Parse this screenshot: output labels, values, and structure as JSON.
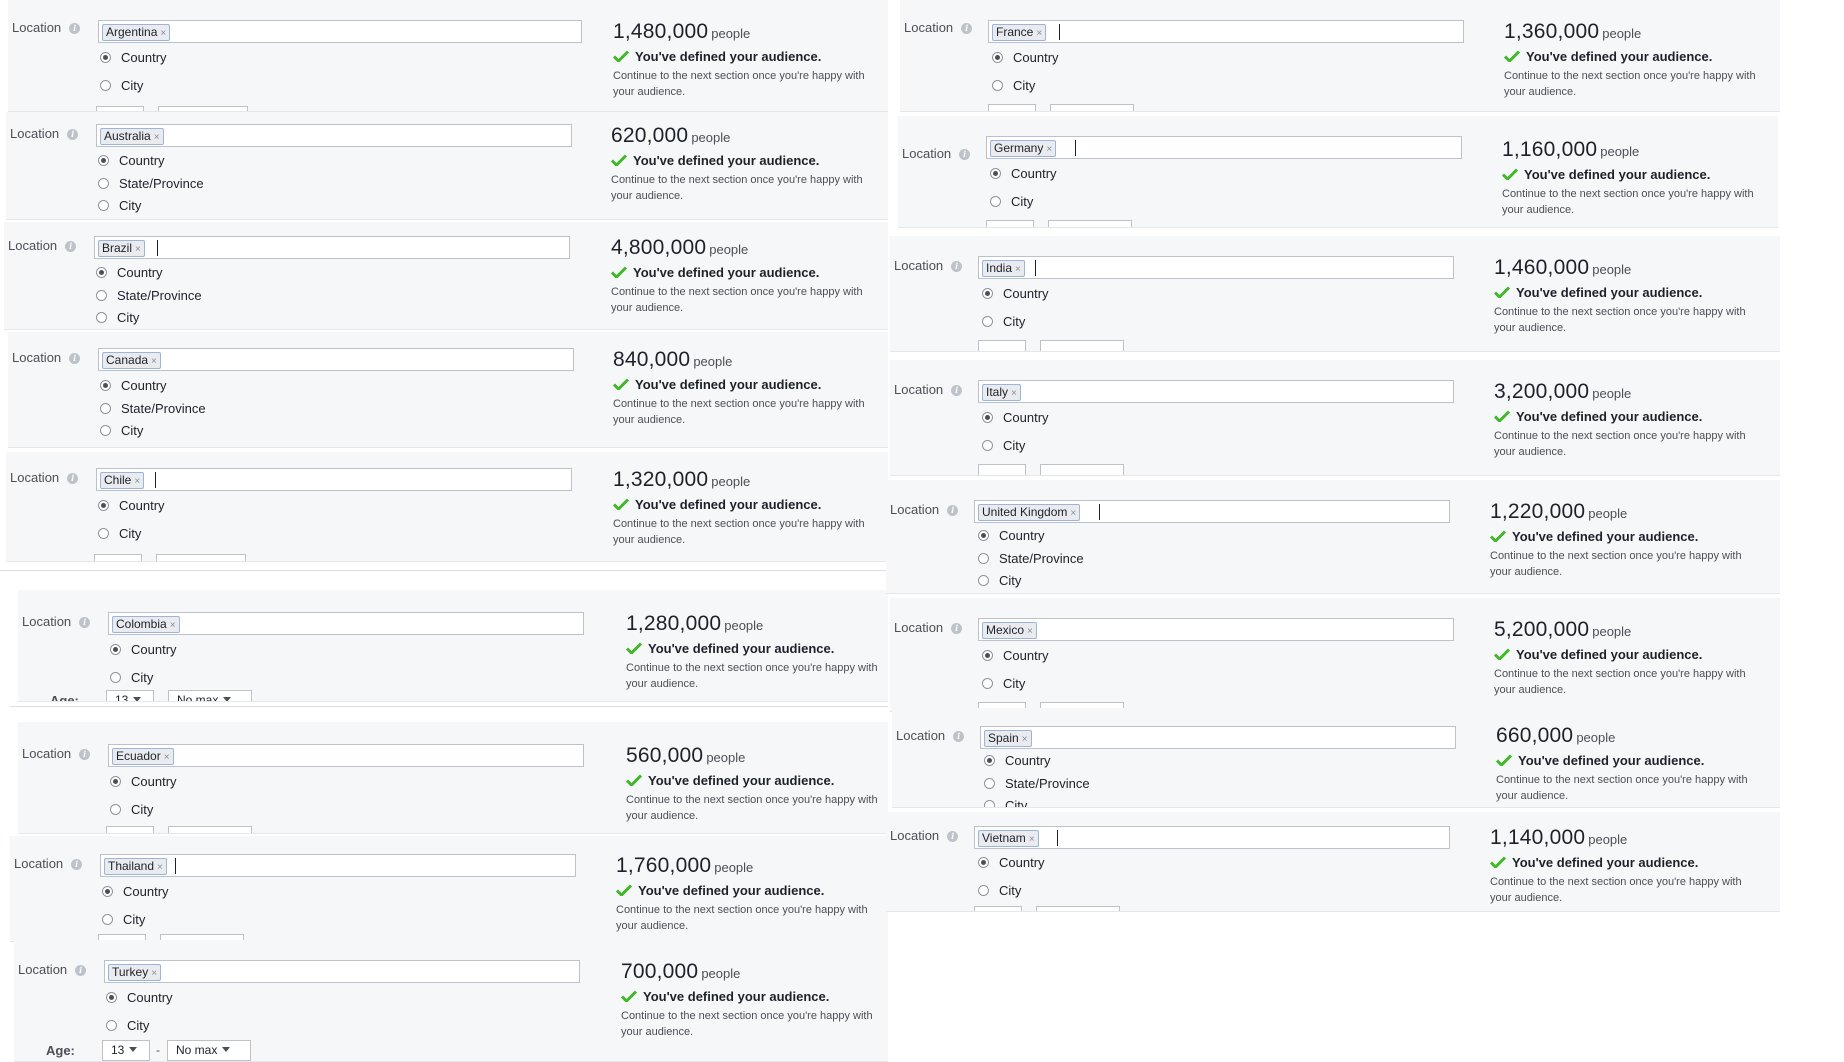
{
  "common": {
    "location_label": "Location",
    "info_icon": "i",
    "remove_icon": "×",
    "people_label": "people",
    "defined_text": "You've defined your audience.",
    "help_text": "Continue to the next section once you're happy with your audience.",
    "age_label": "Age:",
    "age_min": "13",
    "age_max": "No max",
    "age_separator": "-",
    "accent_green": "#42b72a"
  },
  "panels": [
    {
      "country": "Argentina",
      "count": "1,480,000",
      "options": [
        {
          "label": "Country",
          "selected": true
        },
        {
          "label": "City",
          "selected": false
        }
      ],
      "caret": false
    },
    {
      "country": "Australia",
      "count": "620,000",
      "options": [
        {
          "label": "Country",
          "selected": true
        },
        {
          "label": "State/Province",
          "selected": false
        },
        {
          "label": "City",
          "selected": false
        }
      ],
      "caret": false
    },
    {
      "country": "Brazil",
      "count": "4,800,000",
      "options": [
        {
          "label": "Country",
          "selected": true
        },
        {
          "label": "State/Province",
          "selected": false
        },
        {
          "label": "City",
          "selected": false
        }
      ],
      "caret": true
    },
    {
      "country": "Canada",
      "count": "840,000",
      "options": [
        {
          "label": "Country",
          "selected": true
        },
        {
          "label": "State/Province",
          "selected": false
        },
        {
          "label": "City",
          "selected": false
        }
      ],
      "caret": false
    },
    {
      "country": "Chile",
      "count": "1,320,000",
      "options": [
        {
          "label": "Country",
          "selected": true
        },
        {
          "label": "City",
          "selected": false
        }
      ],
      "caret": true
    },
    {
      "country": "Colombia",
      "count": "1,280,000",
      "options": [
        {
          "label": "Country",
          "selected": true
        },
        {
          "label": "City",
          "selected": false
        }
      ],
      "caret": false
    },
    {
      "country": "Ecuador",
      "count": "560,000",
      "options": [
        {
          "label": "Country",
          "selected": true
        },
        {
          "label": "City",
          "selected": false
        }
      ],
      "caret": false
    },
    {
      "country": "Thailand",
      "count": "1,760,000",
      "options": [
        {
          "label": "Country",
          "selected": true
        },
        {
          "label": "City",
          "selected": false
        }
      ],
      "caret": true
    },
    {
      "country": "Turkey",
      "count": "700,000",
      "options": [
        {
          "label": "Country",
          "selected": true
        },
        {
          "label": "City",
          "selected": false
        }
      ],
      "caret": false
    },
    {
      "country": "France",
      "count": "1,360,000",
      "options": [
        {
          "label": "Country",
          "selected": true
        },
        {
          "label": "City",
          "selected": false
        }
      ],
      "caret": true
    },
    {
      "country": "Germany",
      "count": "1,160,000",
      "options": [
        {
          "label": "Country",
          "selected": true
        },
        {
          "label": "City",
          "selected": false
        }
      ],
      "caret": true
    },
    {
      "country": "India",
      "count": "1,460,000",
      "options": [
        {
          "label": "Country",
          "selected": true
        },
        {
          "label": "City",
          "selected": false
        }
      ],
      "caret": true
    },
    {
      "country": "Italy",
      "count": "3,200,000",
      "options": [
        {
          "label": "Country",
          "selected": true
        },
        {
          "label": "City",
          "selected": false
        }
      ],
      "caret": false
    },
    {
      "country": "United Kingdom",
      "count": "1,220,000",
      "options": [
        {
          "label": "Country",
          "selected": true
        },
        {
          "label": "State/Province",
          "selected": false
        },
        {
          "label": "City",
          "selected": false
        }
      ],
      "caret": true
    },
    {
      "country": "Mexico",
      "count": "5,200,000",
      "options": [
        {
          "label": "Country",
          "selected": true
        },
        {
          "label": "City",
          "selected": false
        }
      ],
      "caret": false
    },
    {
      "country": "Spain",
      "count": "660,000",
      "options": [
        {
          "label": "Country",
          "selected": true
        },
        {
          "label": "State/Province",
          "selected": false
        },
        {
          "label": "City",
          "selected": false
        }
      ],
      "caret": false
    },
    {
      "country": "Vietnam",
      "count": "1,140,000",
      "options": [
        {
          "label": "Country",
          "selected": true
        },
        {
          "label": "City",
          "selected": false
        }
      ],
      "caret": true
    }
  ]
}
